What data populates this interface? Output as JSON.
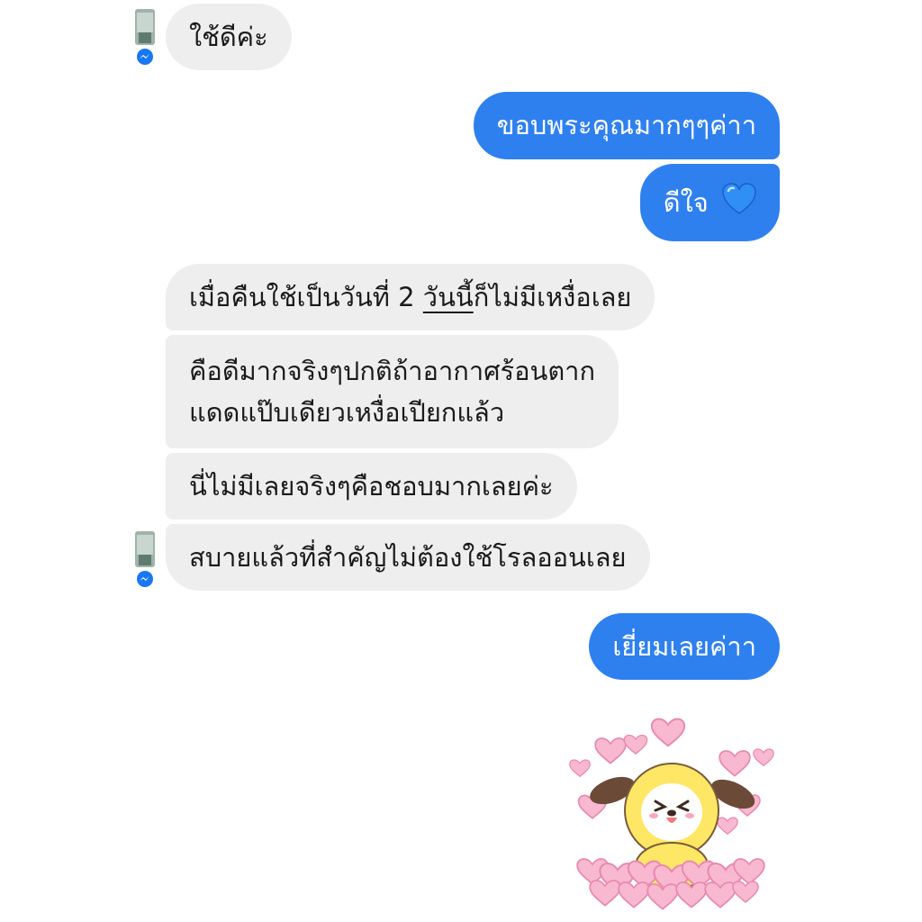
{
  "conversation": {
    "messages": [
      {
        "direction": "incoming",
        "text": "ใช้ดีค่ะ"
      },
      {
        "direction": "outgoing",
        "text": "ขอบพระคุณมากๆๆค่าา"
      },
      {
        "direction": "outgoing",
        "text": "ดีใจ",
        "emoji": "blue-heart-icon"
      },
      {
        "direction": "incoming",
        "text_before": "เมื่อคืนใช้เป็นวันที่ 2 ",
        "text_underlined": "วันนี้",
        "text_after": "ก็ไม่มีเหงื่อเลย"
      },
      {
        "direction": "incoming",
        "line1": "คือดีมากจริงๆปกติถ้าอากาศร้อนตาก",
        "line2": "แดดแป๊บเดียวเหงื่อเปียกแล้ว"
      },
      {
        "direction": "incoming",
        "text": "นี่ไม่มีเลยจริงๆคือชอบมากเลยค่ะ"
      },
      {
        "direction": "incoming",
        "text": "สบายแล้วที่สำคัญไม่ต้องใช้โรลออนเลย"
      },
      {
        "direction": "outgoing",
        "text": "เยี่ยมเลยค่าา"
      }
    ],
    "sticker": "heart-puppy-sticker",
    "colors": {
      "outgoing_bubble": "#2f80ef",
      "incoming_bubble": "#eeeeee",
      "messenger_badge": "#1877f2"
    }
  }
}
